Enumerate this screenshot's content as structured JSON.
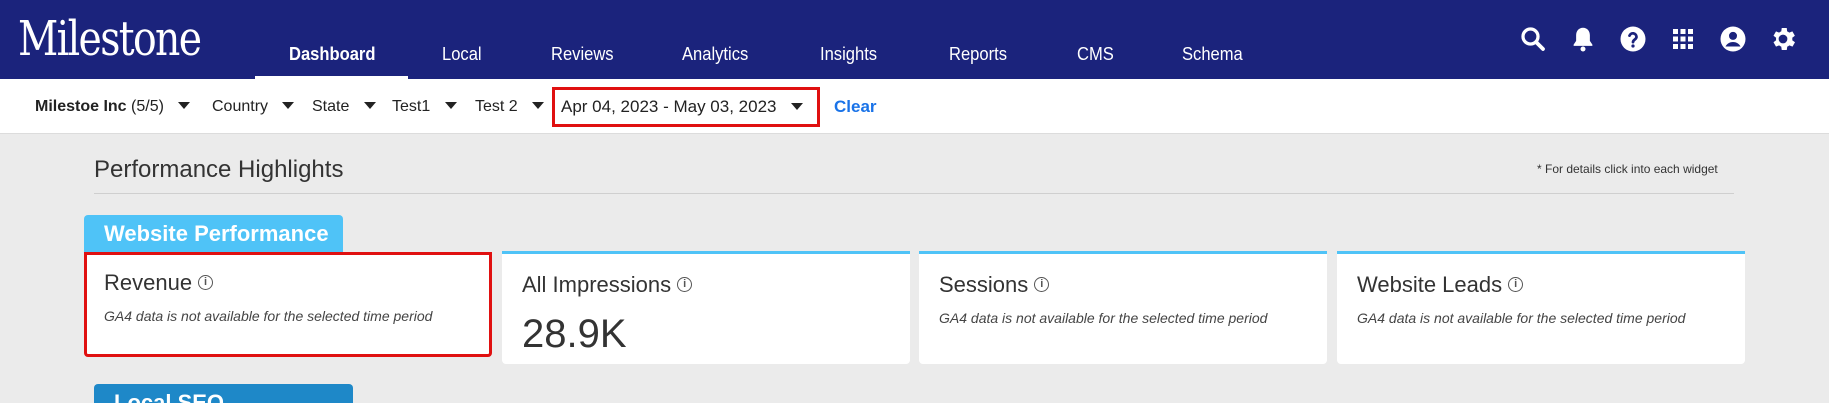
{
  "brand": {
    "logo_text": "Milestone"
  },
  "nav": {
    "items": [
      {
        "label": "Dashboard",
        "active": true
      },
      {
        "label": "Local"
      },
      {
        "label": "Reviews"
      },
      {
        "label": "Analytics"
      },
      {
        "label": "Insights"
      },
      {
        "label": "Reports"
      },
      {
        "label": "CMS"
      },
      {
        "label": "Schema"
      }
    ],
    "icons": [
      "search-icon",
      "bell-icon",
      "help-icon",
      "apps-grid-icon",
      "account-icon",
      "settings-icon"
    ]
  },
  "filters": {
    "account_name": "Milestoe Inc",
    "account_count": "(5/5)",
    "country": "Country",
    "state": "State",
    "test1": "Test1",
    "test2": "Test 2",
    "date_range": "Apr 04, 2023 - May 03, 2023",
    "clear": "Clear"
  },
  "main": {
    "title": "Performance Highlights",
    "note": "* For details click into each widget",
    "website_tab": "Website Performance",
    "local_tab": "Local SEO",
    "cards": [
      {
        "title": "Revenue",
        "note": "GA4 data is not available for the selected time period"
      },
      {
        "title": "All Impressions",
        "value": "28.9K"
      },
      {
        "title": "Sessions",
        "note": "GA4 data is not available for the selected time period"
      },
      {
        "title": "Website Leads",
        "note": "GA4 data is not available for the selected time period"
      }
    ]
  },
  "colors": {
    "topbar": "#1b237c",
    "accent": "#4fc3f7",
    "highlight": "#e01010",
    "link": "#1a73e8"
  }
}
